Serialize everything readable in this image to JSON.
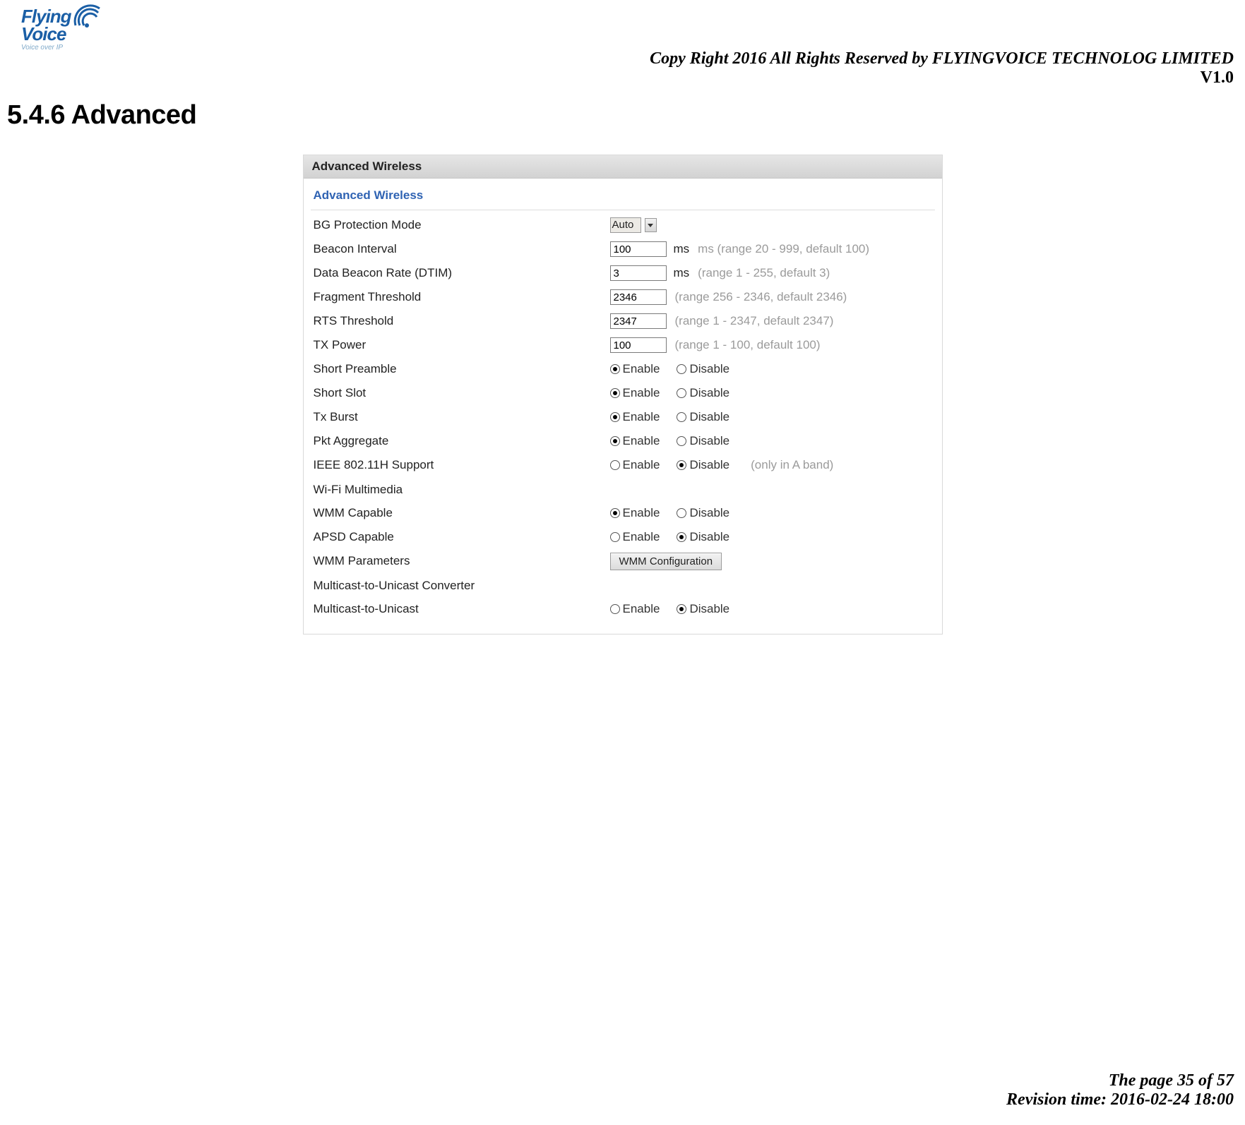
{
  "header": {
    "logo_text1": "Flying",
    "logo_text2": "Voice",
    "logo_sub": "Voice over IP",
    "copyright": "Copy Right 2016 All Rights Reserved by FLYINGVOICE TECHNOLOG LIMITED",
    "version": "V1.0"
  },
  "title": "5.4.6 Advanced",
  "panel": {
    "header": "Advanced Wireless",
    "section": "Advanced Wireless",
    "bg_protection": {
      "label": "BG Protection Mode",
      "value": "Auto"
    },
    "beacon_interval": {
      "label": "Beacon Interval",
      "value": "100",
      "unit": "ms",
      "hint": "ms (range 20 - 999, default 100)"
    },
    "dtim": {
      "label": "Data Beacon Rate (DTIM)",
      "value": "3",
      "unit": "ms",
      "hint": "(range 1 - 255, default 3)"
    },
    "frag": {
      "label": "Fragment Threshold",
      "value": "2346",
      "hint": "(range 256 - 2346, default 2346)"
    },
    "rts": {
      "label": "RTS Threshold",
      "value": "2347",
      "hint": "(range 1 - 2347, default 2347)"
    },
    "txpower": {
      "label": "TX Power",
      "value": "100",
      "hint": "(range 1 - 100, default 100)"
    },
    "radios": {
      "enable": "Enable",
      "disable": "Disable"
    },
    "short_preamble": {
      "label": "Short Preamble",
      "selected": "enable"
    },
    "short_slot": {
      "label": "Short Slot",
      "selected": "enable"
    },
    "tx_burst": {
      "label": "Tx Burst",
      "selected": "enable"
    },
    "pkt_aggregate": {
      "label": "Pkt Aggregate",
      "selected": "enable"
    },
    "ieee80211h": {
      "label": "IEEE 802.11H Support",
      "selected": "disable",
      "note": "(only in A band)"
    },
    "wifi_mm_header": "Wi-Fi Multimedia",
    "wmm_capable": {
      "label": "WMM Capable",
      "selected": "enable"
    },
    "apsd_capable": {
      "label": "APSD Capable",
      "selected": "disable"
    },
    "wmm_params": {
      "label": "WMM Parameters",
      "button": "WMM Configuration"
    },
    "m2u_header": "Multicast-to-Unicast Converter",
    "m2u": {
      "label": "Multicast-to-Unicast",
      "selected": "disable"
    }
  },
  "footer": {
    "page": "The page 35 of 57",
    "revision": "Revision time: 2016-02-24 18:00"
  }
}
